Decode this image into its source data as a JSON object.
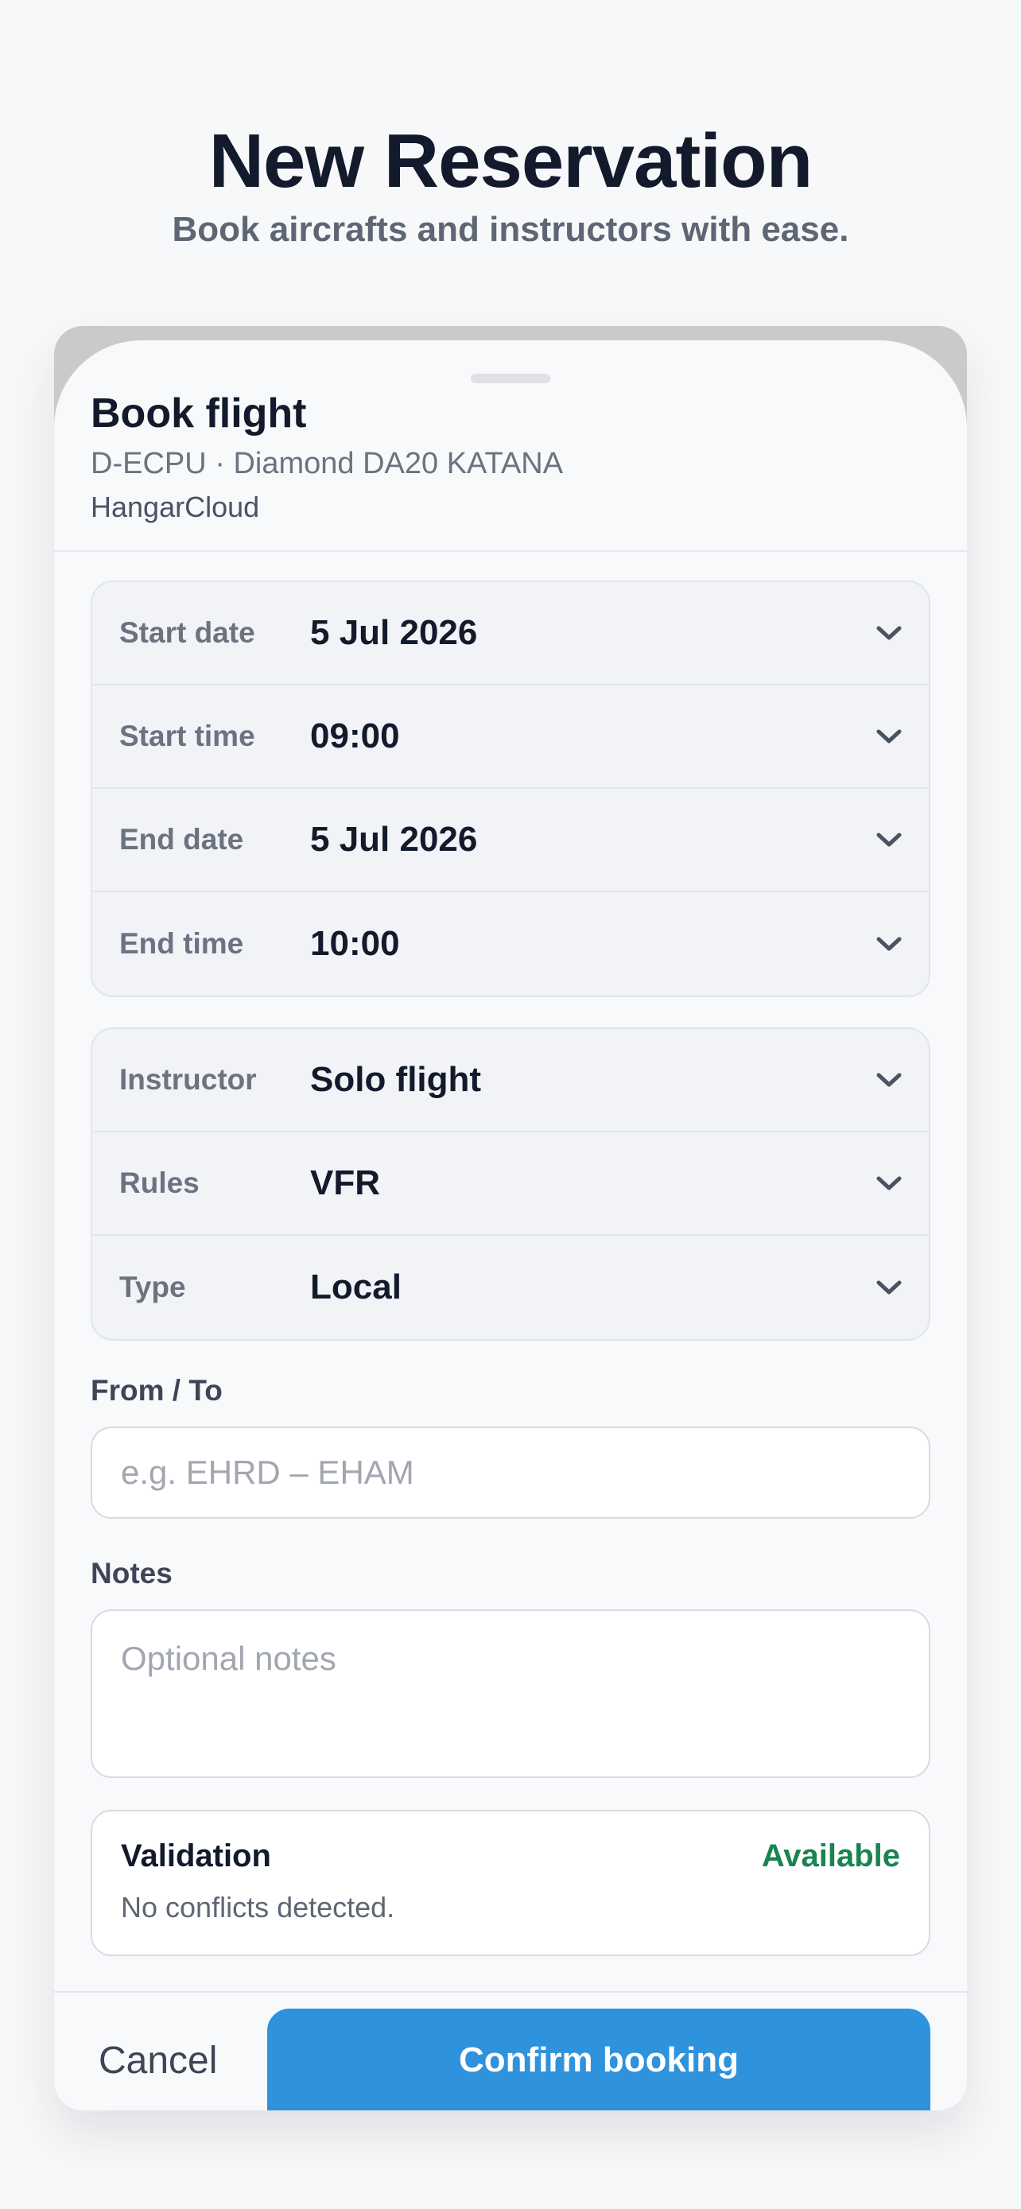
{
  "hero": {
    "title": "New Reservation",
    "subtitle": "Book aircrafts and instructors with ease."
  },
  "sheet": {
    "title": "Book flight",
    "aircraft": "D-ECPU · Diamond DA20 KATANA",
    "organization": "HangarCloud"
  },
  "schedule": [
    {
      "label": "Start date",
      "value": "5 Jul 2026"
    },
    {
      "label": "Start time",
      "value": "09:00"
    },
    {
      "label": "End date",
      "value": "5 Jul 2026"
    },
    {
      "label": "End time",
      "value": "10:00"
    }
  ],
  "flight": [
    {
      "label": "Instructor",
      "value": "Solo flight"
    },
    {
      "label": "Rules",
      "value": "VFR"
    },
    {
      "label": "Type",
      "value": "Local"
    }
  ],
  "route": {
    "label": "From / To",
    "value": "",
    "placeholder": "e.g. EHRD – EHAM"
  },
  "notes": {
    "label": "Notes",
    "value": "",
    "placeholder": "Optional notes"
  },
  "validation": {
    "title": "Validation",
    "status": "Available",
    "message": "No conflicts detected."
  },
  "actions": {
    "cancel_label": "Cancel",
    "confirm_label": "Confirm booking"
  },
  "colors": {
    "accent": "#2f92dc",
    "success": "#198450"
  },
  "icons": {
    "row_chevron": "chevron-down-icon"
  }
}
